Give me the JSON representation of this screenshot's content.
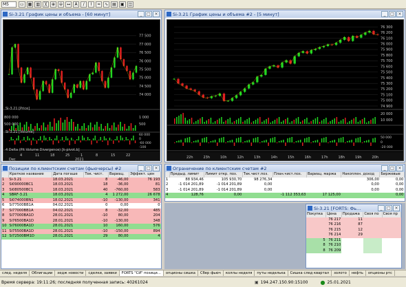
{
  "toolbar": {
    "symbol": "M5",
    "buttons": [
      "▭",
      "▦",
      "▥",
      "╳",
      "⊕",
      "⊖",
      "↔",
      "A",
      "/",
      "⌇",
      "≈",
      "∿",
      "▤",
      "▣",
      "◫"
    ]
  },
  "win_left": {
    "title": "Si-3.21 График цены и объема - [60 минут]"
  },
  "win_right": {
    "title": "Si-3.21 График цены и объема #2 - [5 минут]"
  },
  "left_chart": {
    "price_label": "Si-3.21 [Price]",
    "volume_label": "Si-3.21 [Volume]",
    "delta_label": "4  Delta (Pit Volume Divergence) [k-pivot.b]",
    "price_ticks": [
      "77 500",
      "77 000",
      "76 500",
      "76 000",
      "75 500",
      "75 000",
      "74 500",
      "74 000"
    ],
    "volume_ticks": [
      "1 000",
      "500"
    ],
    "vol_left": [
      "800 000",
      "500 000"
    ],
    "delta_ticks": [
      "60 000",
      "0",
      "-60 000",
      "-100"
    ],
    "x_ticks": [
      "4",
      "11",
      "18",
      "25",
      "1",
      "8",
      "15",
      "22"
    ],
    "x_ticks2": [
      "Dec",
      "2021"
    ]
  },
  "right_chart": {
    "price_ticks": [
      "76 300",
      "76 200",
      "76 100",
      "76 000",
      "75 900",
      "75 800",
      "75 700",
      "75 600",
      "75 500",
      "75 400",
      "75 300",
      "75 200",
      "75 100",
      "75 000",
      "74 900"
    ],
    "volume_ticks": [
      "20 000",
      "10 000"
    ],
    "delta_ticks": [
      "50 000",
      "0",
      "-20 000"
    ],
    "x_ticks": [
      "22h",
      "23h",
      "10h",
      "12h",
      "13h",
      "14h",
      "15h",
      "16h",
      "17h",
      "18h",
      "19h",
      "20h"
    ]
  },
  "chart_data": [
    {
      "type": "line",
      "title": "Si-3.21 [Price] 60 минут",
      "series": [
        {
          "name": "Si-3.21",
          "values": [
            75200,
            76800,
            77000,
            75600,
            74700,
            75200,
            75600,
            75000,
            74300,
            73700,
            74200,
            74800,
            74600,
            74100,
            74900,
            75500,
            75400,
            74700,
            74300,
            73800,
            74100,
            74600,
            74400,
            74800,
            74300,
            74800,
            75200,
            75300,
            75900,
            75400,
            74800,
            74400,
            75000,
            75600,
            76200,
            76800,
            76100,
            75700,
            75400,
            74900,
            75300,
            75700
          ]
        }
      ],
      "ylim": [
        73600,
        77700
      ]
    },
    {
      "type": "line",
      "title": "Si-3.21 [Price] 5 минут",
      "series": [
        {
          "name": "Si-3.21",
          "values": [
            75380,
            75300,
            75260,
            75210,
            75190,
            75160,
            75100,
            75050,
            75040,
            75070,
            75080,
            75120,
            74990,
            74990,
            75040,
            75090,
            75150,
            75210,
            75280,
            75320,
            75420,
            75450,
            75560,
            75600,
            75620,
            75580,
            75670,
            75710,
            75650,
            75780,
            75840,
            75870,
            75830,
            75890,
            75910,
            75940,
            75960,
            75990,
            75980,
            76020,
            76070,
            76120,
            76050,
            76140,
            76110,
            76160,
            76200,
            76230,
            76170,
            76160
          ]
        }
      ],
      "ylim": [
        74900,
        76350
      ]
    }
  ],
  "positions": {
    "title": "Позиции по клиентским счетам (фьючерсы) #2",
    "columns": [
      "",
      "Краткое название",
      "Дата погаше",
      "Тек. чист.",
      "Вариац.",
      "Эффект. цен"
    ],
    "rows": [
      [
        "1",
        "Si-3.21",
        "18.03.2021",
        "8",
        "-46,00",
        "76 193"
      ],
      [
        "2",
        "Si090000BC1",
        "18.03.2021",
        "18",
        "-36,00",
        "81"
      ],
      [
        "3",
        "Si080500BC1",
        "18.03.2021",
        "40",
        "-760,00",
        "583"
      ],
      [
        "4",
        "SBRF-3.21",
        "18.03.2021",
        "4",
        "1 272,00",
        "26 678"
      ],
      [
        "5",
        "Si074000BN1",
        "18.02.2021",
        "-10",
        "-130,00",
        "341"
      ],
      [
        "6",
        "Si77500BB1A",
        "04.02.2021",
        "0",
        "0,00",
        "0"
      ],
      [
        "7",
        "Si77000BB1A",
        "04.02.2021",
        "8",
        "-32,00",
        "485"
      ],
      [
        "8",
        "Si77000BA1D",
        "28.01.2021",
        "-10",
        "80,00",
        "204"
      ],
      [
        "9",
        "Si76500BA1D",
        "28.01.2021",
        "-10",
        "-130,00",
        "348"
      ],
      [
        "10",
        "Si76000BA1D",
        "28.01.2021",
        "10",
        "160,00",
        "576"
      ],
      [
        "11",
        "Si75500BA1D",
        "28.01.2021",
        "-10",
        "-150,00",
        "894"
      ],
      [
        "12",
        "Si72500BM1D",
        "28.01.2021",
        "29",
        "80,00",
        "4"
      ]
    ],
    "row_colors": [
      "#f8b8b8",
      "#f8b8b8",
      "#f8b8b8",
      "#90dd90",
      "#f8b8b8",
      "#ffffff",
      "#f8b8b8",
      "#f8b8b8",
      "#f8b8b8",
      "#90dd90",
      "#f8b8b8",
      "#90dd90"
    ]
  },
  "limits": {
    "title": "Ограничение по клиентским счетам #2",
    "columns": [
      "Предыд. лимит",
      "Лимит откр. поз.",
      "Тек.чист.поз.",
      "План.чист.поз.",
      "Вариац. маржа",
      "Накоплен. доход",
      "Биржевые"
    ],
    "rows": [
      [
        "88 934,46",
        "105 930,70",
        "98 276,34",
        "",
        "",
        "306,00",
        "0,00"
      ],
      [
        "-1 014 201,89",
        "-1 014 201,89",
        "0,00",
        "",
        "",
        "0,00",
        "0,00"
      ],
      [
        "-1 014 201,89",
        "-1 014 201,89",
        "0,00",
        "",
        "",
        "0,00",
        "0,00"
      ],
      [
        "128,76",
        "0,00",
        "",
        "-1 112 353,63",
        "17 125,00",
        "",
        "0,00"
      ]
    ],
    "row_nums": [
      "1",
      "2",
      "3",
      "4"
    ]
  },
  "forts": {
    "title": "Si-3.21 [FORTS: Фь…",
    "columns": [
      "Покупка",
      "Цена",
      "Продажа",
      "Своя по",
      "Своя пр"
    ],
    "rows": [
      [
        "",
        "76 217",
        "11",
        "",
        ""
      ],
      [
        "",
        "76 216",
        "87",
        "",
        ""
      ],
      [
        "",
        "76 215",
        "12",
        "",
        ""
      ],
      [
        "",
        "76 214",
        "29",
        "",
        ""
      ],
      [
        "5",
        "76 211",
        "",
        "",
        ""
      ],
      [
        "8",
        "76 210",
        "",
        "",
        ""
      ],
      [
        "8",
        "76 209",
        "",
        "",
        ""
      ]
    ]
  },
  "tabs": [
    "след. неделя",
    "Облигации",
    "хедж новости",
    "сделки, заявки",
    "FORTS \"СИ\" позици…",
    "опционы сишка",
    "Сбер фьюч",
    "коллы неделя",
    "путы неделька",
    "Сишка след квартал",
    "золото",
    "нефть",
    "опционы ртс"
  ],
  "status": {
    "server_time": "Время сервера: 19:11:26; последняя полученная запись: 40261024",
    "ip": "194.247.150.90:15100",
    "date": "25.01.2021"
  }
}
